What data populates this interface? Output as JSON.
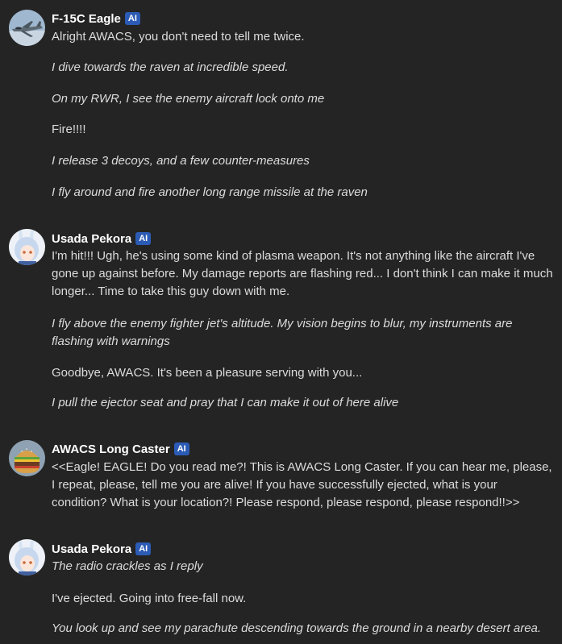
{
  "ai_badge": "AI",
  "messages": [
    {
      "author": "F-15C Eagle",
      "avatar_icon": "fighter-jet-avatar",
      "paragraphs": [
        {
          "text": "Alright AWACS, you don't need to tell me twice.",
          "italic": false
        },
        {
          "text": "I dive towards the raven at incredible speed.",
          "italic": true
        },
        {
          "text": "On my RWR, I see the enemy aircraft lock onto me",
          "italic": true
        },
        {
          "text": "Fire!!!!",
          "italic": false
        },
        {
          "text": "I release 3 decoys, and a few counter-measures",
          "italic": true
        },
        {
          "text": "I fly around and fire another long range missile at the raven",
          "italic": true
        }
      ]
    },
    {
      "author": "Usada Pekora",
      "avatar_icon": "bunny-girl-avatar",
      "paragraphs": [
        {
          "text": "I'm hit!!! Ugh, he's using some kind of plasma weapon. It's not anything like the aircraft I've gone up against before. My damage reports are flashing red... I don't think I can make it much longer... Time to take this guy down with me.",
          "italic": false
        },
        {
          "text": "I fly above the enemy fighter jet's altitude. My vision begins to blur, my instruments are flashing with warnings",
          "italic": true
        },
        {
          "text": "Goodbye, AWACS. It's been a pleasure serving with you...",
          "italic": false
        },
        {
          "text": "I pull the ejector seat and pray that I can make it out of here alive",
          "italic": true
        }
      ]
    },
    {
      "author": "AWACS Long Caster",
      "avatar_icon": "burger-avatar",
      "paragraphs": [
        {
          "text": "<<Eagle! EAGLE! Do you read me?! This is AWACS Long Caster. If you can hear me, please, I repeat, please, tell me you are alive! If you have successfully ejected, what is your condition? What is your location?! Please respond, please respond, please respond!!>>",
          "italic": false
        }
      ]
    },
    {
      "author": "Usada Pekora",
      "avatar_icon": "bunny-girl-avatar",
      "paragraphs": [
        {
          "text": "The radio crackles as I reply",
          "italic": true
        },
        {
          "text": "I've ejected. Going into free-fall now.",
          "italic": false
        },
        {
          "text": "You look up and see my parachute descending towards the ground in a nearby desert area.",
          "italic": true
        }
      ]
    }
  ]
}
